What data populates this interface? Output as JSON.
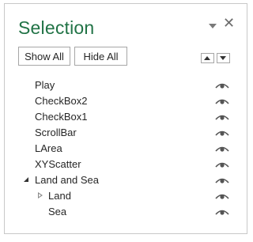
{
  "pane": {
    "title": "Selection",
    "accent_color": "#217346",
    "options_icon": "dropdown-triangle-icon",
    "close_glyph": "✕"
  },
  "toolbar": {
    "show_all_label": "Show All",
    "hide_all_label": "Hide All",
    "bring_forward_icon": "triangle-up-icon",
    "send_backward_icon": "triangle-down-icon"
  },
  "objects": [
    {
      "label": "Play",
      "visible": true
    },
    {
      "label": "CheckBox2",
      "visible": true
    },
    {
      "label": "CheckBox1",
      "visible": true
    },
    {
      "label": "ScrollBar",
      "visible": true
    },
    {
      "label": "LArea",
      "visible": true
    },
    {
      "label": "XYScatter",
      "visible": true
    },
    {
      "label": "Land and Sea",
      "visible": true,
      "group": true,
      "expanded": true
    },
    {
      "label": "Land",
      "visible": true,
      "group": true,
      "expanded": false,
      "child": true
    },
    {
      "label": "Sea",
      "visible": true,
      "child": true
    }
  ]
}
